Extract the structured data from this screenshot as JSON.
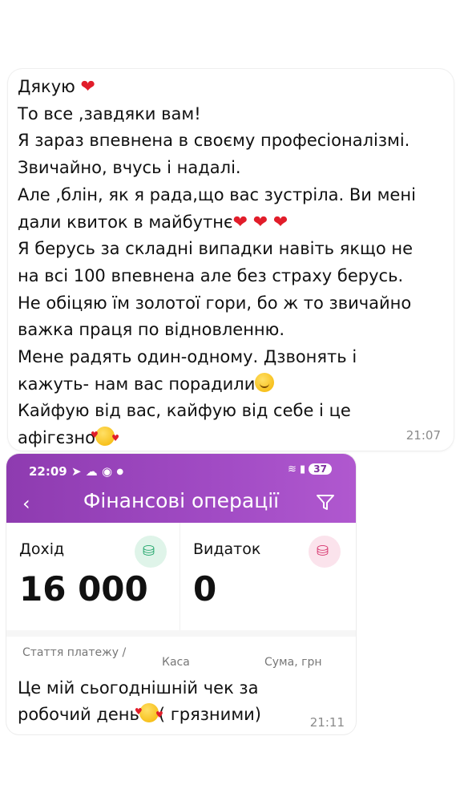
{
  "message": {
    "lines": [
      "Дякую",
      "То все ,завдяки вам!",
      "Я зараз впевнена в своєму професіоналізмі.",
      "Звичайно, вчусь і надалі.",
      "Але ,блін,  як я рада,що вас зустріла. Ви мені",
      "дали квиток в майбутнє",
      "Я берусь за складні випадки  навіть якщо не",
      "на всі 100 впевнена але без страху берусь.",
      "Не обіцяю їм золотої гори, бо ж то звичайно",
      "важка праця по відновленню.",
      "Мене радять один-одному. Дзвонять і",
      "кажуть- нам вас порадили",
      "Кайфую від вас, кайфую від себе і це",
      "афігєзно"
    ],
    "time": "21:07"
  },
  "screenshot": {
    "status_time": "22:09",
    "battery": "37",
    "title": "Фінансові операції",
    "income_label": "Дохід",
    "income_value": "16 000",
    "expense_label": "Видаток",
    "expense_value": "0",
    "columns": [
      "Стаття платежу /",
      "Каса",
      "Сума, грн"
    ]
  },
  "caption": {
    "line1": "Це мій сьогоднішній чек за",
    "line2": "робочий день",
    "line2_suffix": "( грязними)",
    "time": "21:11"
  },
  "colors": {
    "accent": "#9a44bf",
    "heart": "#e11d2a",
    "income_icon": "#1fa56a",
    "expense_icon": "#d6336c"
  }
}
